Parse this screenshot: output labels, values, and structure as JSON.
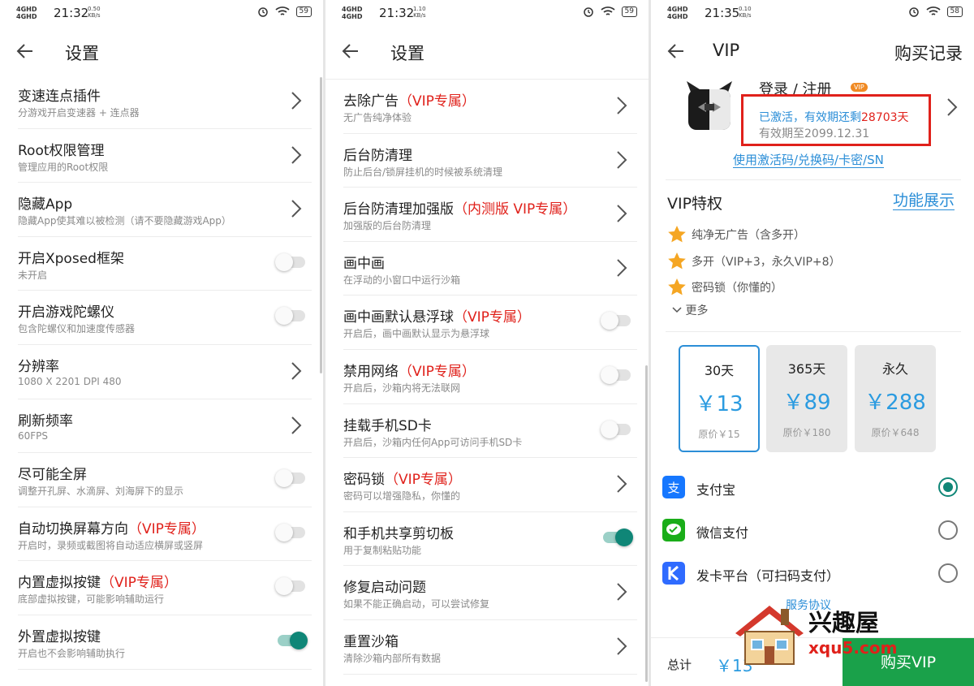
{
  "status": {
    "net": "4GHD",
    "panels": [
      {
        "time": "21:32",
        "speed": "0.50",
        "speed_unit": "KB/s",
        "battery": "59"
      },
      {
        "time": "21:32",
        "speed": "1.10",
        "speed_unit": "KB/s",
        "battery": "59"
      },
      {
        "time": "21:35",
        "speed": "0.10",
        "speed_unit": "KB/s",
        "battery": "58"
      }
    ]
  },
  "settings1": {
    "title": "设置",
    "items": [
      {
        "title": "变速连点插件",
        "vip": "",
        "sub": "分游戏开启变速器 + 连点器",
        "control": "chevron"
      },
      {
        "title": "Root权限管理",
        "vip": "",
        "sub": "管理应用的Root权限",
        "control": "chevron"
      },
      {
        "title": "隐藏App",
        "vip": "",
        "sub": "隐藏App使其难以被检测（请不要隐藏游戏App）",
        "control": "chevron"
      },
      {
        "title": "开启Xposed框架",
        "vip": "",
        "sub": "未开启",
        "control": "toggle-off"
      },
      {
        "title": "开启游戏陀螺仪",
        "vip": "",
        "sub": "包含陀螺仪和加速度传感器",
        "control": "toggle-off"
      },
      {
        "title": "分辨率",
        "vip": "",
        "sub": "1080 X 2201 DPI 480",
        "control": "chevron"
      },
      {
        "title": "刷新频率",
        "vip": "",
        "sub": "60FPS",
        "control": "chevron"
      },
      {
        "title": "尽可能全屏",
        "vip": "",
        "sub": "调整开孔屏、水滴屏、刘海屏下的显示",
        "control": "toggle-off"
      },
      {
        "title": "自动切换屏幕方向",
        "vip": "（VIP专属）",
        "sub": "开启时，录频或截图将自动适应横屏或竖屏",
        "control": "toggle-off"
      },
      {
        "title": "内置虚拟按键",
        "vip": "（VIP专属）",
        "sub": "底部虚拟按键，可能影响辅助运行",
        "control": "toggle-off"
      },
      {
        "title": "外置虚拟按键",
        "vip": "",
        "sub": "开启也不会影响辅助执行",
        "control": "toggle-on"
      }
    ]
  },
  "settings2": {
    "title": "设置",
    "items": [
      {
        "title": "去除广告",
        "vip": "（VIP专属）",
        "sub": "无广告纯净体验",
        "control": "chevron"
      },
      {
        "title": "后台防清理",
        "vip": "",
        "sub": "防止后台/锁屏挂机的时候被系统清理",
        "control": "chevron"
      },
      {
        "title": "后台防清理加强版",
        "vip": "（内测版 VIP专属）",
        "sub": "加强版的后台防清理",
        "control": "chevron"
      },
      {
        "title": "画中画",
        "vip": "",
        "sub": "在浮动的小窗口中运行沙箱",
        "control": "chevron"
      },
      {
        "title": "画中画默认悬浮球",
        "vip": "（VIP专属）",
        "sub": "开启后，画中画默认显示为悬浮球",
        "control": "toggle-off"
      },
      {
        "title": "禁用网络",
        "vip": "（VIP专属）",
        "sub": "开启后，沙箱内将无法联网",
        "control": "toggle-off"
      },
      {
        "title": "挂载手机SD卡",
        "vip": "",
        "sub": "开启后，沙箱内任何App可访问手机SD卡",
        "control": "toggle-off"
      },
      {
        "title": "密码锁",
        "vip": "（VIP专属）",
        "sub": "密码可以增强隐私，你懂的",
        "control": "chevron"
      },
      {
        "title": "和手机共享剪切板",
        "vip": "",
        "sub": "用于复制粘贴功能",
        "control": "toggle-on"
      },
      {
        "title": "修复启动问题",
        "vip": "",
        "sub": "如果不能正确启动，可以尝试修复",
        "control": "chevron"
      },
      {
        "title": "重置沙箱",
        "vip": "",
        "sub": "清除沙箱内部所有数据",
        "control": "chevron"
      }
    ]
  },
  "vip": {
    "title": "VIP",
    "purchase_record": "购买记录",
    "login": "登录 / 注册",
    "badge": "VIP",
    "activated_prefix": "已激活，有效期还剩",
    "activated_days": "28703天",
    "expiry": "有效期至2099.12.31",
    "code_link": "使用激活码/兑换码/卡密/SN",
    "privileges_title": "VIP特权",
    "feature_link": "功能展示",
    "perks": [
      "纯净无广告（含多开）",
      "多开（VIP+3，永久VIP+8）",
      "密码锁（你懂的）"
    ],
    "more": "更多",
    "plans": [
      {
        "name": "30天",
        "price": "￥13",
        "original": "原价￥15",
        "selected": true
      },
      {
        "name": "365天",
        "price": "￥89",
        "original": "原价￥180",
        "selected": false
      },
      {
        "name": "永久",
        "price": "￥288",
        "original": "原价￥648",
        "selected": false
      }
    ],
    "payments": [
      {
        "name": "支付宝",
        "icon": "alipay-icon",
        "color": "#1677ff",
        "selected": true
      },
      {
        "name": "微信支付",
        "icon": "wechat-pay-icon",
        "color": "#1aad19",
        "selected": false
      },
      {
        "name": "发卡平台（可扫码支付）",
        "icon": "card-platform-icon",
        "color": "#2f6bff",
        "selected": false
      }
    ],
    "service": "服务协议",
    "total_label": "总计",
    "total_price": "￥13",
    "buy": "购买VIP"
  },
  "watermark": {
    "name": "兴趣屋",
    "url": "xqu5.com"
  },
  "colors": {
    "vip_red": "#e0211b",
    "link_blue": "#2b8ed7",
    "toggle_green": "#0f8677",
    "buy_green": "#1aa14a"
  }
}
